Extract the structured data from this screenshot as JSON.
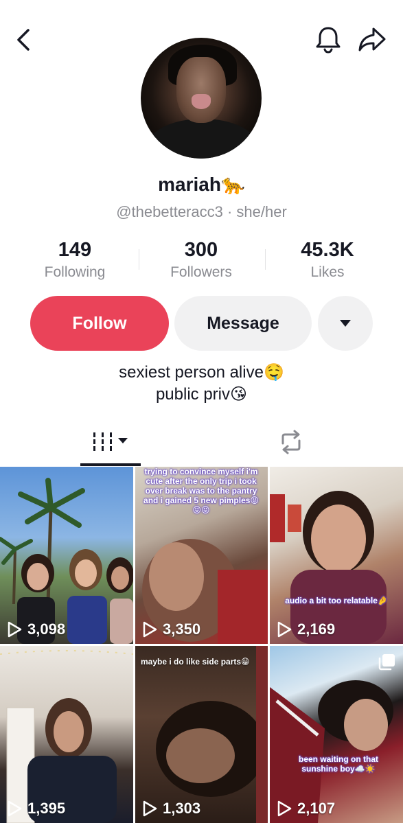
{
  "profile": {
    "username": "mariah🐆",
    "handle": "@thebetteracc3 · she/her",
    "bio_line1": "sexiest person alive🤤",
    "bio_line2": "public priv😘"
  },
  "stats": [
    {
      "value": "149",
      "label": "Following"
    },
    {
      "value": "300",
      "label": "Followers"
    },
    {
      "value": "45.3K",
      "label": "Likes"
    }
  ],
  "actions": {
    "follow_label": "Follow",
    "message_label": "Message"
  },
  "videos": [
    {
      "views": "3,098",
      "caption": ""
    },
    {
      "views": "3,350",
      "caption": "trying to convince myself i'm cute after the only trip i took over break was to the pantry and i gained 5 new pimples😝 😝😝"
    },
    {
      "views": "2,169",
      "caption": "audio a bit too relatable🤌"
    },
    {
      "views": "1,395",
      "caption": ""
    },
    {
      "views": "1,303",
      "caption": "maybe i do like side parts😁"
    },
    {
      "views": "2,107",
      "caption": "been waiting on that sunshine boy☁️☀️"
    }
  ],
  "colors": {
    "follow": "#ea4359",
    "secondary_button": "#f1f1f2",
    "muted_text": "#8a8b91",
    "primary_text": "#161823"
  },
  "icons": {
    "back": "chevron-left-icon",
    "notifications": "bell-icon",
    "share": "share-arrow-icon",
    "more": "caret-down-icon",
    "videos_tab": "grid-columns-icon",
    "reposts_tab": "repost-icon",
    "play": "play-icon"
  }
}
